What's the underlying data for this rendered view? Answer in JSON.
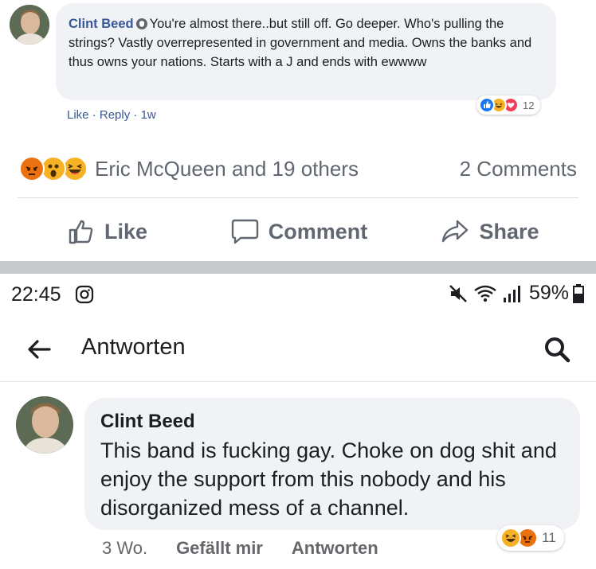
{
  "top_comment": {
    "author": "Clint Beed",
    "text": "You're almost there..but still off. Go deeper. Who's pulling the strings? Vastly overrepresented in government and media. Owns the banks and thus owns your nations. Starts with a J and ends with ewwww",
    "like_label": "Like",
    "reply_label": "Reply",
    "age": "1w",
    "sep": " · ",
    "reaction_count": "12",
    "reactions": [
      "like",
      "haha",
      "love"
    ]
  },
  "post_summary": {
    "reactions": [
      "angry",
      "wow",
      "haha"
    ],
    "reactors": "Eric McQueen and 19 others",
    "comments": "2 Comments"
  },
  "actions": {
    "like": "Like",
    "comment": "Comment",
    "share": "Share"
  },
  "status_bar": {
    "time": "22:45",
    "battery": "59%",
    "icons": [
      "instagram-icon",
      "mute-icon",
      "wifi-icon",
      "signal-icon",
      "battery-icon"
    ]
  },
  "app_bar": {
    "title": "Antworten"
  },
  "reply_comment": {
    "author": "Clint Beed",
    "text": "This band is fucking gay. Choke on dog shit and enjoy the support from this nobody and his disorganized mess of a channel.",
    "age": "3 Wo.",
    "like_label": "Gefällt mir",
    "reply_label": "Antworten",
    "reaction_count": "11",
    "reactions": [
      "haha",
      "angry"
    ]
  },
  "colors": {
    "link_blue": "#385898",
    "bubble_bg": "#f0f2f5",
    "muted_text": "#606770",
    "like_blue": "#1877f2",
    "love_red": "#f33e58",
    "haha_yellow": "#f7b125",
    "angry_orange": "#e9710f"
  }
}
